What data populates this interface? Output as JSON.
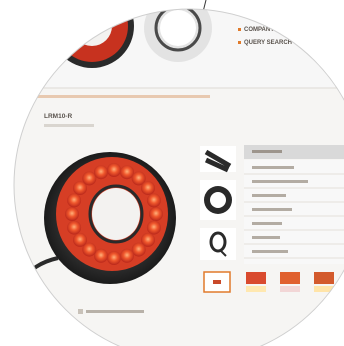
{
  "header_links": [
    "COMPANY",
    "QUERY SEARCH"
  ],
  "breadcrumb": "",
  "product": {
    "title": "LRM10-R",
    "subtitle": ""
  },
  "spec_rows": [
    "",
    "",
    "",
    "",
    "",
    "",
    ""
  ],
  "footer_note": "",
  "colors": {
    "accent_red": "#d8412a",
    "ring_body": "#2b2b2b",
    "panel_bg": "#efefef",
    "lens_edge": "#cfcfcf"
  },
  "icons": [
    "magnifier-handle-icon",
    "ring-light-icon",
    "chevron-icon"
  ]
}
